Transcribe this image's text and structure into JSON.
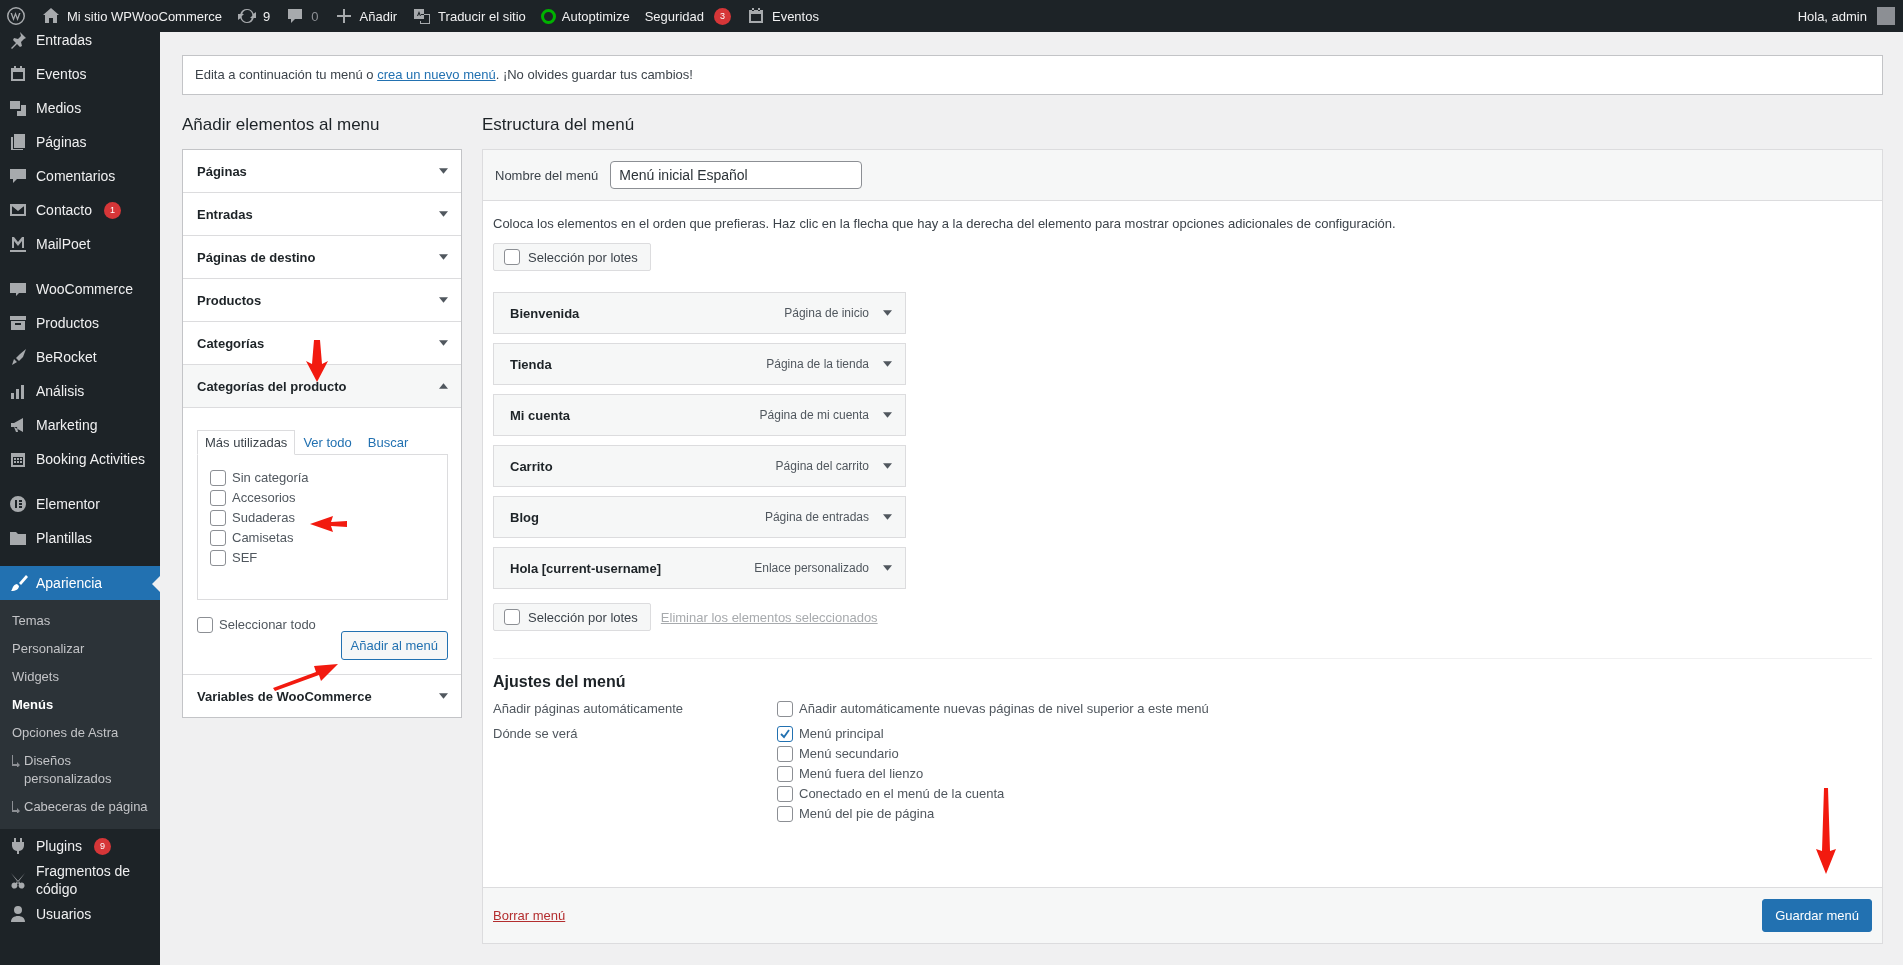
{
  "admin_bar": {
    "site": "Mi sitio WPWooCommerce",
    "updates": "9",
    "comments": "0",
    "new": "Añadir",
    "translate": "Traducir el sitio",
    "optimizer": {
      "label": "Autoptimize",
      "color": "#00b300"
    },
    "security": {
      "label": "Seguridad",
      "badge": "3"
    },
    "events": "Eventos",
    "account": "Hola, admin"
  },
  "sidebar": {
    "groups": [
      {
        "items": [
          {
            "label": "Entradas",
            "selected": false
          },
          {
            "label": "Eventos",
            "selected": false
          },
          {
            "label": "Medios",
            "selected": false
          },
          {
            "label": "Páginas",
            "selected": false
          },
          {
            "label": "Comentarios",
            "selected": false
          },
          {
            "label": "Contacto",
            "badge": "1",
            "selected": false
          },
          {
            "label": "MailPoet",
            "selected": false
          }
        ]
      },
      {
        "items": [
          {
            "label": "WooCommerce",
            "selected": false
          },
          {
            "label": "Productos",
            "selected": false
          },
          {
            "label": "BeRocket",
            "selected": false
          },
          {
            "label": "Análisis",
            "selected": false
          },
          {
            "label": "Marketing",
            "selected": false
          },
          {
            "label": "Booking Activities",
            "selected": false
          }
        ]
      },
      {
        "items": [
          {
            "label": "Elementor",
            "selected": false
          },
          {
            "label": "Plantillas",
            "selected": false
          }
        ]
      },
      {
        "items": [
          {
            "label": "Apariencia",
            "selected": true,
            "children": [
              {
                "label": "Temas",
                "selected": false
              },
              {
                "label": "Personalizar",
                "selected": false
              },
              {
                "label": "Widgets",
                "selected": false
              },
              {
                "label": "Menús",
                "selected": true
              },
              {
                "label": "Opciones de Astra",
                "selected": false,
                "children": [
                  {
                    "label": "Diseños personalizados",
                    "selected": false
                  },
                  {
                    "label": "Cabeceras de página",
                    "selected": false
                  }
                ]
              }
            ]
          },
          {
            "label": "Plugins",
            "badge": "9",
            "selected": false
          },
          {
            "label": "Fragmentos de código",
            "selected": false
          },
          {
            "label": "Usuarios",
            "selected": false
          }
        ]
      }
    ]
  },
  "notice": {
    "before": "Edita a continuación tu menú o",
    "link": "crea un nuevo menú",
    "after": ". ¡No olvides guardar tus cambios!"
  },
  "add_panel": {
    "title": "Añadir elementos al menu",
    "sections": [
      {
        "label": "Páginas",
        "expanded": false
      },
      {
        "label": "Entradas",
        "expanded": false
      },
      {
        "label": "Páginas de destino",
        "expanded": false
      },
      {
        "label": "Productos",
        "expanded": false
      },
      {
        "label": "Categorías",
        "expanded": false
      },
      {
        "label": "Categorías del producto",
        "expanded": true,
        "tabs": [
          {
            "label": "Más utilizadas",
            "selected": true
          },
          {
            "label": "Ver todo",
            "selected": false
          },
          {
            "label": "Buscar",
            "selected": false
          }
        ],
        "items": [
          {
            "label": "Sin categoría",
            "checked": false
          },
          {
            "label": "Accesorios",
            "checked": false
          },
          {
            "label": "Sudaderas",
            "checked": false
          },
          {
            "label": "Camisetas",
            "checked": false
          },
          {
            "label": "SEF",
            "checked": false
          }
        ],
        "select_all": {
          "label": "Seleccionar todo",
          "checked": false
        },
        "button": "Añadir al menú"
      },
      {
        "label": "Variables de WooCommerce",
        "expanded": false
      }
    ]
  },
  "structure": {
    "title": "Estructura del menú",
    "name_label": "Nombre del menú",
    "name_value": "Menú inicial Español",
    "instructions": "Coloca los elementos en el orden que prefieras. Haz clic en la flecha que hay a la derecha del elemento para mostrar opciones adicionales de configuración.",
    "bulk_top": {
      "label": "Selección por lotes",
      "checked": false
    },
    "items": [
      {
        "title": "Bienvenida",
        "type": "Página de inicio"
      },
      {
        "title": "Tienda",
        "type": "Página de la tienda"
      },
      {
        "title": "Mi cuenta",
        "type": "Página de mi cuenta"
      },
      {
        "title": "Carrito",
        "type": "Página del carrito"
      },
      {
        "title": "Blog",
        "type": "Página de entradas"
      },
      {
        "title": "Hola [current-username]",
        "type": "Enlace personalizado"
      }
    ],
    "bulk_bottom": {
      "label": "Selección por lotes",
      "checked": false
    },
    "delete_selected": "Eliminar los elementos seleccionados",
    "settings": {
      "title": "Ajustes del menú",
      "rows": [
        {
          "label": "Añadir páginas automáticamente",
          "options": [
            {
              "label": "Añadir automáticamente nuevas páginas de nivel superior a este menú",
              "checked": false
            }
          ]
        },
        {
          "label": "Dónde se verá",
          "options": [
            {
              "label": "Menú principal",
              "checked": true
            },
            {
              "label": "Menú secundario",
              "checked": false
            },
            {
              "label": "Menú fuera del lienzo",
              "checked": false
            },
            {
              "label": "Conectado en el menú de la cuenta",
              "checked": false
            },
            {
              "label": "Menú del pie de página",
              "checked": false
            }
          ]
        }
      ]
    },
    "delete_menu": "Borrar menú",
    "save": "Guardar menú"
  }
}
